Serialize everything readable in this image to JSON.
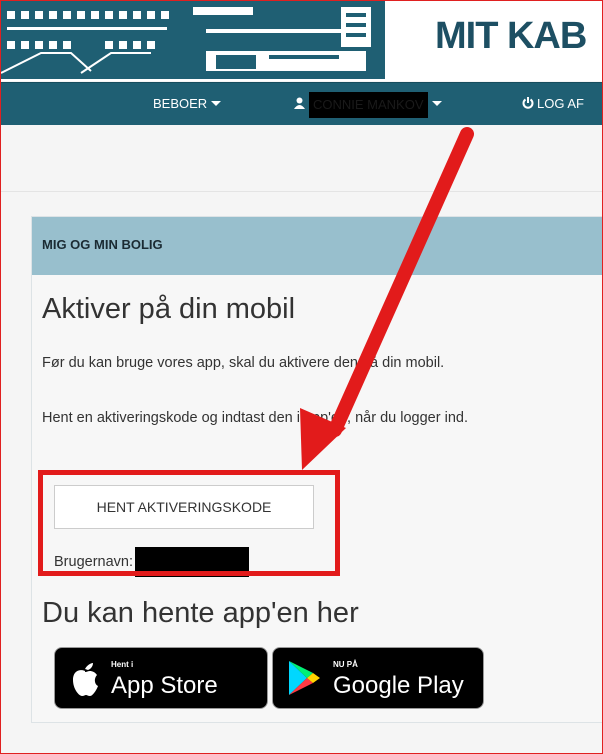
{
  "header": {
    "brand": "MIT KAB",
    "nav": {
      "beboer_label": "BEBOER",
      "user_name": "CONNIE MANKOV",
      "logout_label": "LOG AF"
    }
  },
  "panel": {
    "heading": "MIG OG MIN BOLIG",
    "activate_title": "Aktiver på din mobil",
    "paragraph1": "Før du kan bruge vores app, skal du aktivere den på din mobil.",
    "paragraph2": "Hent en aktiveringskode og indtast den i app'en, når du logger ind.",
    "fetch_button": "HENT AKTIVERINGSKODE",
    "username_label": "Brugernavn:",
    "get_app_title": "Du kan hente app'en her"
  },
  "stores": {
    "appstore_small": "Hent i",
    "appstore_big": "App Store",
    "googleplay_small": "NU PÅ",
    "googleplay_big": "Google Play"
  },
  "colors": {
    "navbar": "#1f5f73",
    "brand": "#1d4f63",
    "panel_heading": "#98bfcd",
    "annotation_red": "#e21b1b"
  }
}
